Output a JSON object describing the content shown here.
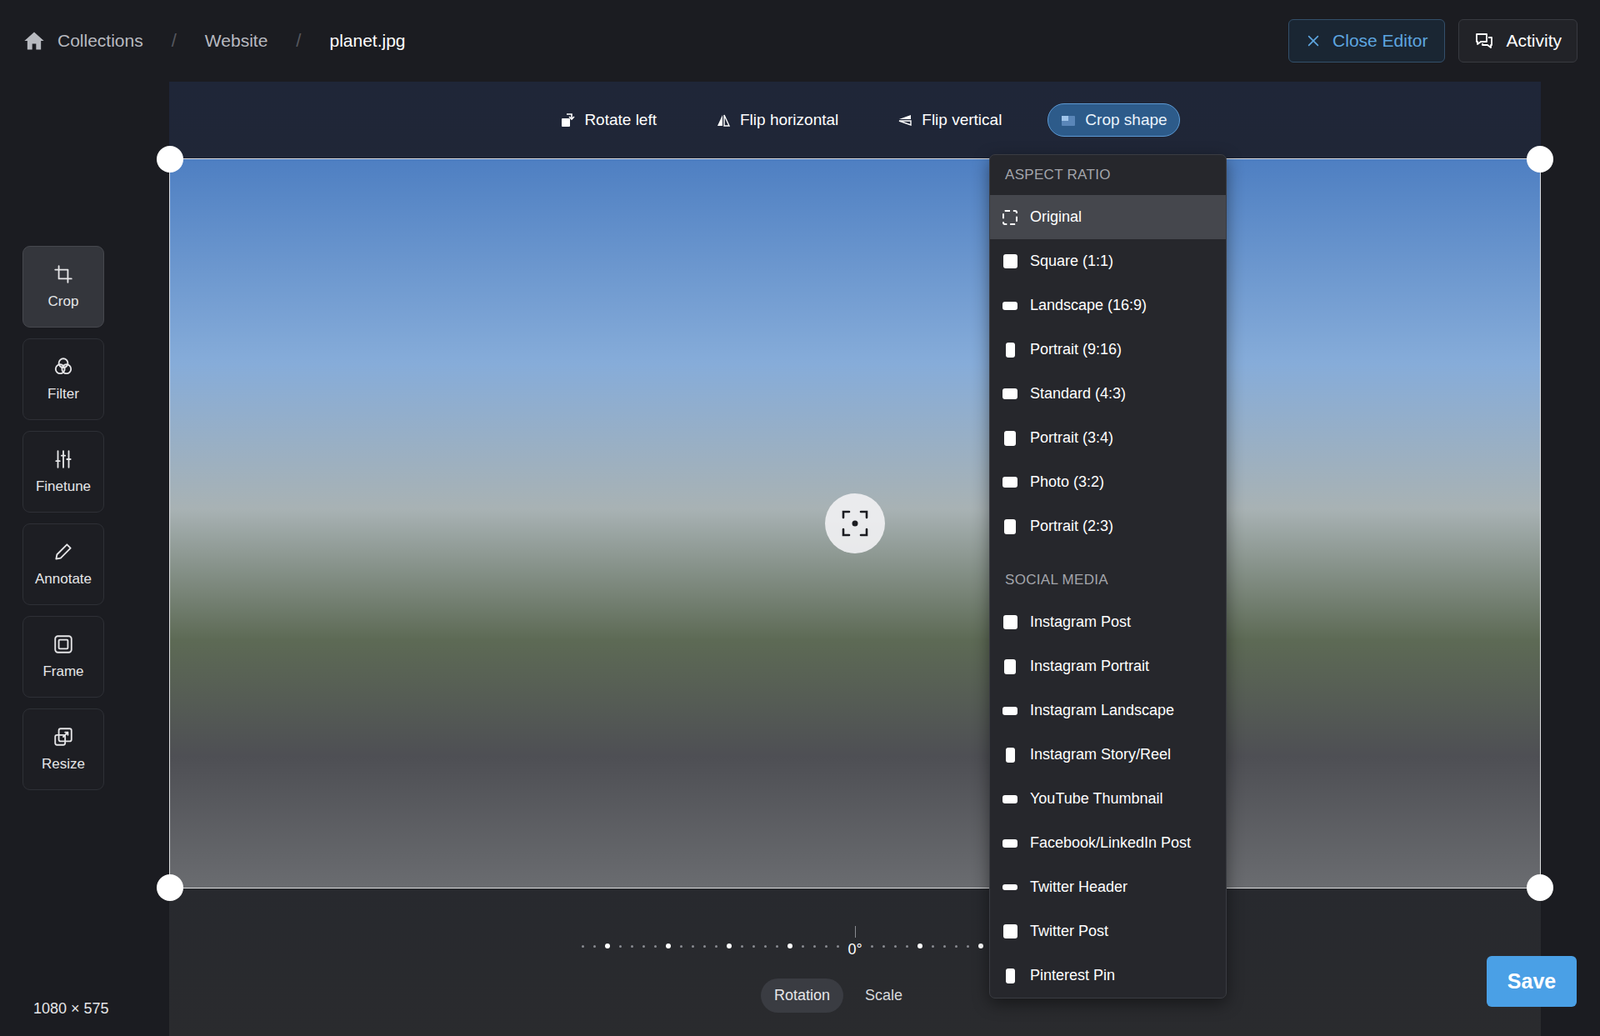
{
  "breadcrumbs": [
    {
      "label": "Collections",
      "current": false
    },
    {
      "label": "Website",
      "current": false
    },
    {
      "label": "planet.jpg",
      "current": true
    }
  ],
  "breadcrumb_separator": "/",
  "header_buttons": [
    {
      "label": "Close Editor",
      "kind": "close"
    },
    {
      "label": "Activity",
      "kind": "activity"
    }
  ],
  "tools": [
    {
      "label": "Crop",
      "kind": "crop",
      "selected": true
    },
    {
      "label": "Filter",
      "kind": "filter",
      "selected": false
    },
    {
      "label": "Finetune",
      "kind": "finetune",
      "selected": false
    },
    {
      "label": "Annotate",
      "kind": "annotate",
      "selected": false
    },
    {
      "label": "Frame",
      "kind": "frame",
      "selected": false
    },
    {
      "label": "Resize",
      "kind": "resize",
      "selected": false
    }
  ],
  "image_size": "1080 × 575",
  "toolbar": [
    {
      "label": "Rotate left",
      "kind": "rotate",
      "selected": false
    },
    {
      "label": "Flip horizontal",
      "kind": "fliph",
      "selected": false
    },
    {
      "label": "Flip vertical",
      "kind": "flipv",
      "selected": false
    },
    {
      "label": "Crop shape",
      "kind": "shape",
      "selected": true
    }
  ],
  "menu": {
    "sections": [
      {
        "title": "ASPECT RATIO",
        "items": [
          {
            "label": "Original",
            "kind": "original",
            "selected": true
          },
          {
            "label": "Square (1:1)",
            "kind": "square",
            "selected": false
          },
          {
            "label": "Landscape (16:9)",
            "kind": "wide",
            "selected": false
          },
          {
            "label": "Portrait (9:16)",
            "kind": "tall",
            "selected": false
          },
          {
            "label": "Standard (4:3)",
            "kind": "standard",
            "selected": false
          },
          {
            "label": "Portrait (3:4)",
            "kind": "upright",
            "selected": false
          },
          {
            "label": "Photo (3:2)",
            "kind": "standard",
            "selected": false
          },
          {
            "label": "Portrait (2:3)",
            "kind": "upright",
            "selected": false
          }
        ]
      },
      {
        "title": "SOCIAL MEDIA",
        "items": [
          {
            "label": "Instagram Post",
            "kind": "square",
            "selected": false
          },
          {
            "label": "Instagram Portrait",
            "kind": "upright",
            "selected": false
          },
          {
            "label": "Instagram Landscape",
            "kind": "wide",
            "selected": false
          },
          {
            "label": "Instagram Story/Reel",
            "kind": "tall",
            "selected": false
          },
          {
            "label": "YouTube Thumbnail",
            "kind": "wide",
            "selected": false
          },
          {
            "label": "Facebook/LinkedIn Post",
            "kind": "wide",
            "selected": false
          },
          {
            "label": "Twitter Header",
            "kind": "banner",
            "selected": false
          },
          {
            "label": "Twitter Post",
            "kind": "square",
            "selected": false
          },
          {
            "label": "Pinterest Pin",
            "kind": "tall",
            "selected": false
          }
        ]
      }
    ]
  },
  "rotation": {
    "reading": "0°"
  },
  "adjust_tabs": [
    {
      "label": "Rotation",
      "selected": true
    },
    {
      "label": "Scale",
      "selected": false
    }
  ],
  "save": "Save"
}
